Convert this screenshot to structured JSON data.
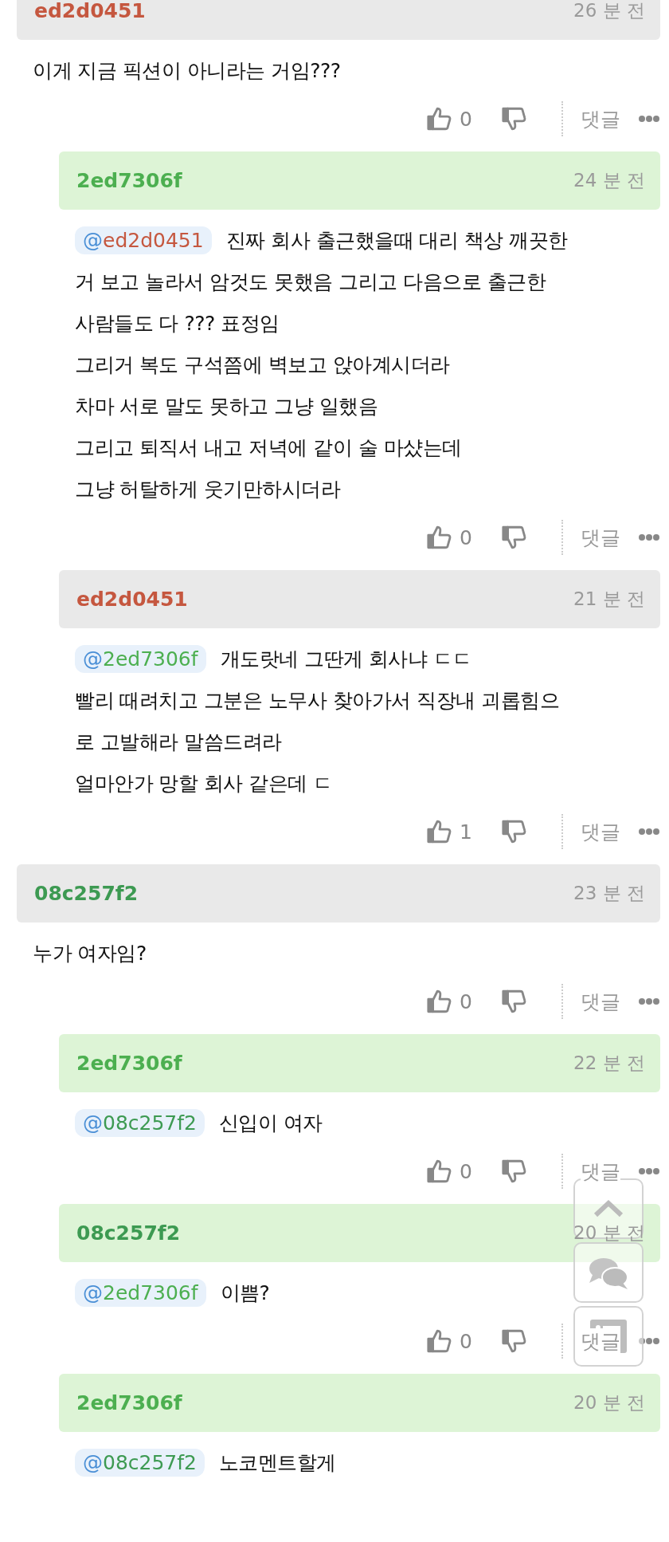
{
  "comments": [
    {
      "author": "ed2d0451",
      "color": "#c5573f",
      "highlighted": false,
      "time": "26 분 전",
      "lines": [
        "이게 지금 픽션이 아니라는 거임???"
      ],
      "likes": "0",
      "reply_label": "댓글",
      "children": [
        {
          "author": "2ed7306f",
          "color": "#4caf50",
          "highlighted": true,
          "time": "24 분 전",
          "mention": {
            "symbol": "@",
            "user": "ed2d0451",
            "color": "#c5573f"
          },
          "lines": [
            "진짜 회사 출근했을때 대리 책상 깨끗한",
            "거 보고 놀라서 암것도 못했음 그리고 다음으로 출근한",
            "사람들도 다 ??? 표정임",
            "그리거 복도 구석쯤에 벽보고 앉아계시더라",
            "차마 서로 말도 못하고 그냥 일했음",
            "그리고 퇴직서 내고 저녁에 같이 술 마샸는데",
            "그냥 허탈하게 웃기만하시더라"
          ],
          "likes": "0",
          "reply_label": "댓글"
        },
        {
          "author": "ed2d0451",
          "color": "#c5573f",
          "highlighted": false,
          "time": "21 분 전",
          "mention": {
            "symbol": "@",
            "user": "2ed7306f",
            "color": "#4caf50"
          },
          "lines": [
            "개도랏네 그딴게 회사냐 ㄷㄷ",
            "빨리 때려치고 그분은 노무사 찾아가서 직장내 괴롭힘으",
            "로 고발해라 말씀드려라",
            "얼마안가 망할 회사 같은데 ㄷ"
          ],
          "likes": "1",
          "reply_label": "댓글"
        }
      ]
    },
    {
      "author": "08c257f2",
      "color": "#3d9a52",
      "highlighted": false,
      "time": "23 분 전",
      "lines": [
        "누가 여자임?"
      ],
      "likes": "0",
      "reply_label": "댓글",
      "children": [
        {
          "author": "2ed7306f",
          "color": "#4caf50",
          "highlighted": true,
          "time": "22 분 전",
          "mention": {
            "symbol": "@",
            "user": "08c257f2",
            "color": "#3d9a52"
          },
          "lines": [
            "신입이 여자"
          ],
          "likes": "0",
          "reply_label": "댓글"
        },
        {
          "author": "08c257f2",
          "color": "#3d9a52",
          "highlighted": true,
          "time": "20 분 전",
          "mention": {
            "symbol": "@",
            "user": "2ed7306f",
            "color": "#4caf50"
          },
          "lines": [
            "이쁨?"
          ],
          "likes": "0",
          "reply_label": "댓글"
        },
        {
          "author": "2ed7306f",
          "color": "#4caf50",
          "highlighted": true,
          "time": "20 분 전",
          "mention": {
            "symbol": "@",
            "user": "08c257f2",
            "color": "#3d9a52"
          },
          "lines": [
            "노코멘트할게"
          ]
        }
      ]
    }
  ]
}
